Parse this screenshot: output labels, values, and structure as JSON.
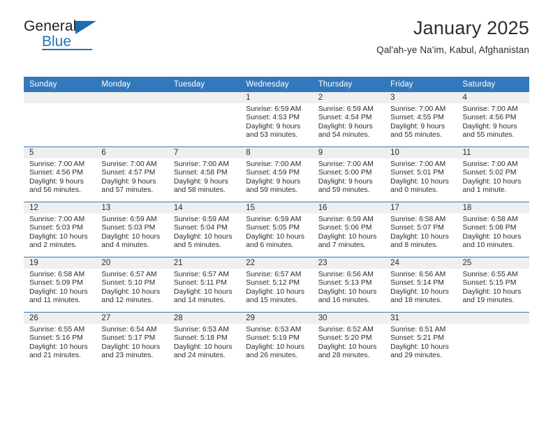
{
  "brand": {
    "name_top": "General",
    "name_bottom": "Blue",
    "accent_color": "#1c75bc"
  },
  "header": {
    "title": "January 2025",
    "subtitle": "Qal'ah-ye Na'im, Kabul, Afghanistan"
  },
  "theme": {
    "header_row_bg": "#3378bc",
    "daynum_band_bg": "#efefef",
    "grid_line": "#3378bc",
    "text": "#2b2b2b"
  },
  "weekdays": [
    "Sunday",
    "Monday",
    "Tuesday",
    "Wednesday",
    "Thursday",
    "Friday",
    "Saturday"
  ],
  "weeks": [
    [
      {
        "day": ""
      },
      {
        "day": ""
      },
      {
        "day": ""
      },
      {
        "day": "1",
        "sunrise": "Sunrise: 6:59 AM",
        "sunset": "Sunset: 4:53 PM",
        "daylight": "Daylight: 9 hours and 53 minutes."
      },
      {
        "day": "2",
        "sunrise": "Sunrise: 6:59 AM",
        "sunset": "Sunset: 4:54 PM",
        "daylight": "Daylight: 9 hours and 54 minutes."
      },
      {
        "day": "3",
        "sunrise": "Sunrise: 7:00 AM",
        "sunset": "Sunset: 4:55 PM",
        "daylight": "Daylight: 9 hours and 55 minutes."
      },
      {
        "day": "4",
        "sunrise": "Sunrise: 7:00 AM",
        "sunset": "Sunset: 4:56 PM",
        "daylight": "Daylight: 9 hours and 55 minutes."
      }
    ],
    [
      {
        "day": "5",
        "sunrise": "Sunrise: 7:00 AM",
        "sunset": "Sunset: 4:56 PM",
        "daylight": "Daylight: 9 hours and 56 minutes."
      },
      {
        "day": "6",
        "sunrise": "Sunrise: 7:00 AM",
        "sunset": "Sunset: 4:57 PM",
        "daylight": "Daylight: 9 hours and 57 minutes."
      },
      {
        "day": "7",
        "sunrise": "Sunrise: 7:00 AM",
        "sunset": "Sunset: 4:58 PM",
        "daylight": "Daylight: 9 hours and 58 minutes."
      },
      {
        "day": "8",
        "sunrise": "Sunrise: 7:00 AM",
        "sunset": "Sunset: 4:59 PM",
        "daylight": "Daylight: 9 hours and 59 minutes."
      },
      {
        "day": "9",
        "sunrise": "Sunrise: 7:00 AM",
        "sunset": "Sunset: 5:00 PM",
        "daylight": "Daylight: 9 hours and 59 minutes."
      },
      {
        "day": "10",
        "sunrise": "Sunrise: 7:00 AM",
        "sunset": "Sunset: 5:01 PM",
        "daylight": "Daylight: 10 hours and 0 minutes."
      },
      {
        "day": "11",
        "sunrise": "Sunrise: 7:00 AM",
        "sunset": "Sunset: 5:02 PM",
        "daylight": "Daylight: 10 hours and 1 minute."
      }
    ],
    [
      {
        "day": "12",
        "sunrise": "Sunrise: 7:00 AM",
        "sunset": "Sunset: 5:03 PM",
        "daylight": "Daylight: 10 hours and 2 minutes."
      },
      {
        "day": "13",
        "sunrise": "Sunrise: 6:59 AM",
        "sunset": "Sunset: 5:03 PM",
        "daylight": "Daylight: 10 hours and 4 minutes."
      },
      {
        "day": "14",
        "sunrise": "Sunrise: 6:59 AM",
        "sunset": "Sunset: 5:04 PM",
        "daylight": "Daylight: 10 hours and 5 minutes."
      },
      {
        "day": "15",
        "sunrise": "Sunrise: 6:59 AM",
        "sunset": "Sunset: 5:05 PM",
        "daylight": "Daylight: 10 hours and 6 minutes."
      },
      {
        "day": "16",
        "sunrise": "Sunrise: 6:59 AM",
        "sunset": "Sunset: 5:06 PM",
        "daylight": "Daylight: 10 hours and 7 minutes."
      },
      {
        "day": "17",
        "sunrise": "Sunrise: 6:58 AM",
        "sunset": "Sunset: 5:07 PM",
        "daylight": "Daylight: 10 hours and 8 minutes."
      },
      {
        "day": "18",
        "sunrise": "Sunrise: 6:58 AM",
        "sunset": "Sunset: 5:08 PM",
        "daylight": "Daylight: 10 hours and 10 minutes."
      }
    ],
    [
      {
        "day": "19",
        "sunrise": "Sunrise: 6:58 AM",
        "sunset": "Sunset: 5:09 PM",
        "daylight": "Daylight: 10 hours and 11 minutes."
      },
      {
        "day": "20",
        "sunrise": "Sunrise: 6:57 AM",
        "sunset": "Sunset: 5:10 PM",
        "daylight": "Daylight: 10 hours and 12 minutes."
      },
      {
        "day": "21",
        "sunrise": "Sunrise: 6:57 AM",
        "sunset": "Sunset: 5:11 PM",
        "daylight": "Daylight: 10 hours and 14 minutes."
      },
      {
        "day": "22",
        "sunrise": "Sunrise: 6:57 AM",
        "sunset": "Sunset: 5:12 PM",
        "daylight": "Daylight: 10 hours and 15 minutes."
      },
      {
        "day": "23",
        "sunrise": "Sunrise: 6:56 AM",
        "sunset": "Sunset: 5:13 PM",
        "daylight": "Daylight: 10 hours and 16 minutes."
      },
      {
        "day": "24",
        "sunrise": "Sunrise: 6:56 AM",
        "sunset": "Sunset: 5:14 PM",
        "daylight": "Daylight: 10 hours and 18 minutes."
      },
      {
        "day": "25",
        "sunrise": "Sunrise: 6:55 AM",
        "sunset": "Sunset: 5:15 PM",
        "daylight": "Daylight: 10 hours and 19 minutes."
      }
    ],
    [
      {
        "day": "26",
        "sunrise": "Sunrise: 6:55 AM",
        "sunset": "Sunset: 5:16 PM",
        "daylight": "Daylight: 10 hours and 21 minutes."
      },
      {
        "day": "27",
        "sunrise": "Sunrise: 6:54 AM",
        "sunset": "Sunset: 5:17 PM",
        "daylight": "Daylight: 10 hours and 23 minutes."
      },
      {
        "day": "28",
        "sunrise": "Sunrise: 6:53 AM",
        "sunset": "Sunset: 5:18 PM",
        "daylight": "Daylight: 10 hours and 24 minutes."
      },
      {
        "day": "29",
        "sunrise": "Sunrise: 6:53 AM",
        "sunset": "Sunset: 5:19 PM",
        "daylight": "Daylight: 10 hours and 26 minutes."
      },
      {
        "day": "30",
        "sunrise": "Sunrise: 6:52 AM",
        "sunset": "Sunset: 5:20 PM",
        "daylight": "Daylight: 10 hours and 28 minutes."
      },
      {
        "day": "31",
        "sunrise": "Sunrise: 6:51 AM",
        "sunset": "Sunset: 5:21 PM",
        "daylight": "Daylight: 10 hours and 29 minutes."
      },
      {
        "day": ""
      }
    ]
  ]
}
